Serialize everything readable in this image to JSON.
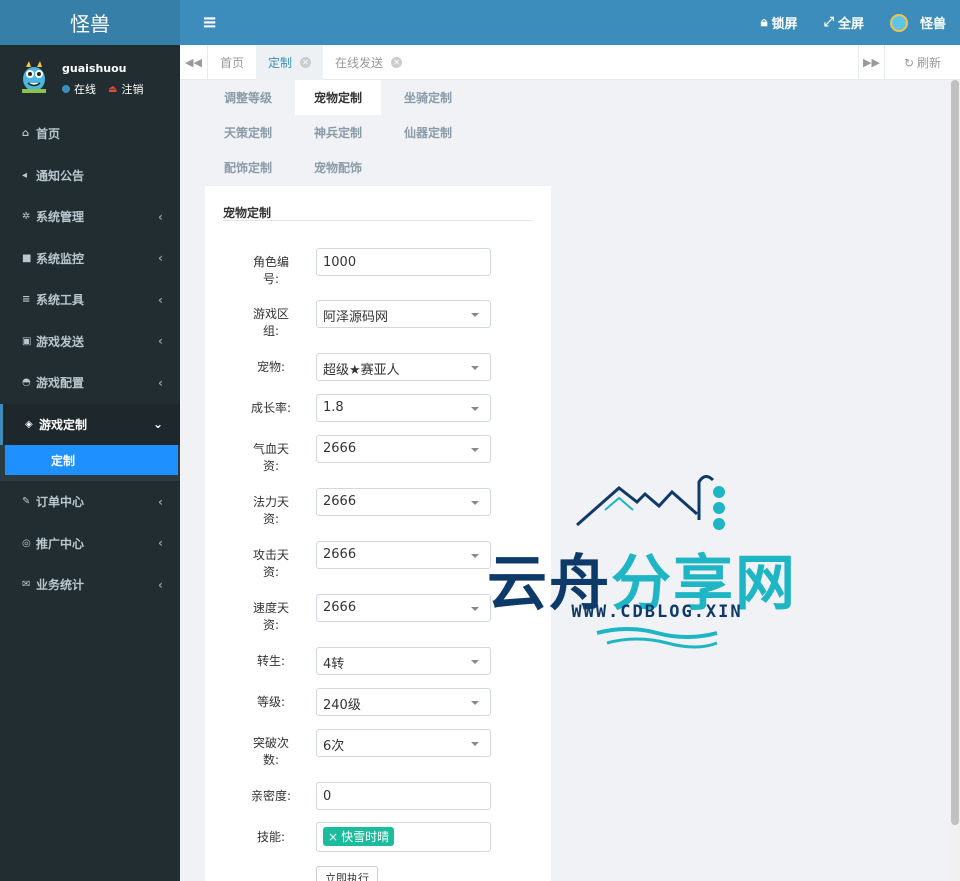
{
  "app": {
    "logo_title": "怪兽"
  },
  "header": {
    "lock_label": "锁屏",
    "fullscreen_label": "全屏",
    "user_label": "怪兽"
  },
  "user_panel": {
    "username": "guaishuou",
    "status": "在线",
    "logout": "注销"
  },
  "sidebar": {
    "items": [
      {
        "label": "首页",
        "icon": "home-icon"
      },
      {
        "label": "通知公告",
        "icon": "bullhorn-icon"
      },
      {
        "label": "系统管理",
        "icon": "gear-icon"
      },
      {
        "label": "系统监控",
        "icon": "video-icon"
      },
      {
        "label": "系统工具",
        "icon": "bars-icon"
      },
      {
        "label": "游戏发送",
        "icon": "gift-icon"
      },
      {
        "label": "游戏配置",
        "icon": "dashboard-icon"
      },
      {
        "label": "游戏定制",
        "icon": "cube-icon"
      },
      {
        "label": "订单中心",
        "icon": "pencil-icon"
      },
      {
        "label": "推广中心",
        "icon": "eye-icon"
      },
      {
        "label": "业务统计",
        "icon": "envelope-icon"
      }
    ],
    "submenu_active": "定制"
  },
  "tabbar": {
    "tabs": [
      {
        "label": "首页"
      },
      {
        "label": "定制"
      },
      {
        "label": "在线发送"
      }
    ],
    "refresh_label": "刷新"
  },
  "subtabs": [
    {
      "label": "调整等级"
    },
    {
      "label": "宠物定制"
    },
    {
      "label": "坐骑定制"
    },
    {
      "label": "天策定制"
    },
    {
      "label": "神兵定制"
    },
    {
      "label": "仙器定制"
    },
    {
      "label": "配饰定制"
    },
    {
      "label": "宠物配饰"
    }
  ],
  "form": {
    "title": "宠物定制",
    "fields": [
      {
        "label": "角色编号:",
        "value": "1000"
      },
      {
        "label": "游戏区组:",
        "value": "阿泽源码网"
      },
      {
        "label": "宠物:",
        "value": "超级★赛亚人"
      },
      {
        "label": "成长率:",
        "value": "1.8"
      },
      {
        "label": "气血天资:",
        "value": "2666"
      },
      {
        "label": "法力天资:",
        "value": "2666"
      },
      {
        "label": "攻击天资:",
        "value": "2666"
      },
      {
        "label": "速度天资:",
        "value": "2666"
      },
      {
        "label": "转生:",
        "value": "4转"
      },
      {
        "label": "等级:",
        "value": "240级"
      },
      {
        "label": "突破次数:",
        "value": "6次"
      },
      {
        "label": "亲密度:",
        "value": "0"
      },
      {
        "label": "技能:",
        "value": "快雪时晴"
      }
    ],
    "submit_label": "立即执行"
  },
  "watermark": {
    "text_part1": "云舟",
    "text_part2": "分享网",
    "url": "WWW.CDBLOG.XIN"
  }
}
